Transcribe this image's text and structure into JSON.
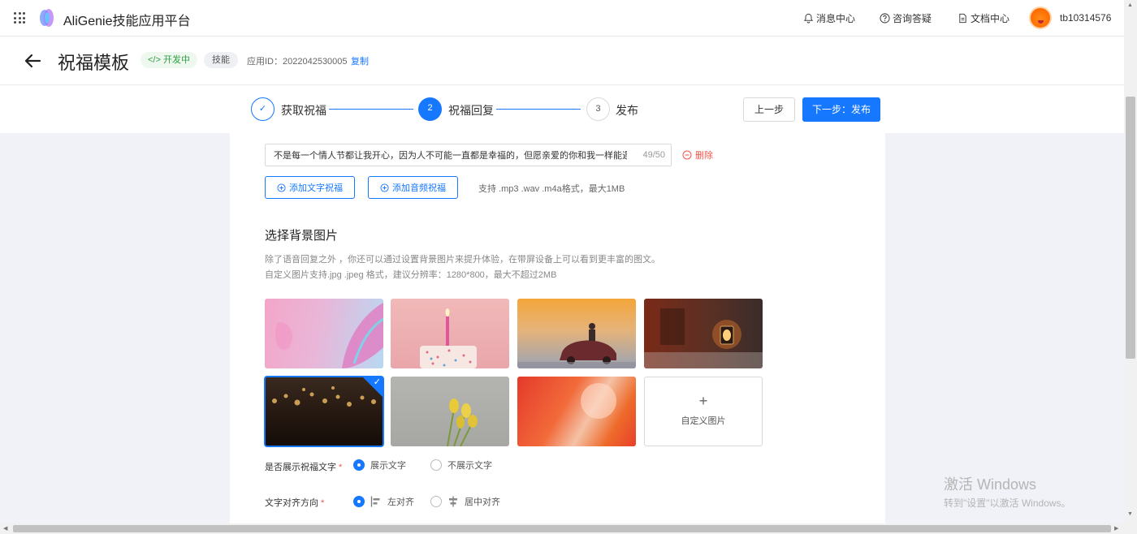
{
  "topnav": {
    "app_title": "AliGenie技能应用平台",
    "messages": "消息中心",
    "faq": "咨询答疑",
    "docs": "文档中心",
    "username": "tb10314576"
  },
  "header": {
    "title": "祝福模板",
    "status_badge": "开发中",
    "type_badge": "技能",
    "app_id": "应用ID：2022042530005",
    "copy_label": "复制"
  },
  "steps": {
    "items": [
      {
        "number": "✓",
        "label": "获取祝福",
        "state": "done"
      },
      {
        "number": "2",
        "label": "祝福回复",
        "state": "active"
      },
      {
        "number": "3",
        "label": "发布",
        "state": "pending"
      }
    ],
    "prev_label": "上一步",
    "next_label": "下一步：发布"
  },
  "blessing": {
    "input_value": "不是每一个情人节都让我开心，因为人不可能一直都是幸福的，但愿亲爱的你和我一样能遇见",
    "char_count": "49/50",
    "delete_label": "删除",
    "add_text_label": "添加文字祝福",
    "add_audio_label": "添加音频祝福",
    "format_hint": "支持 .mp3 .wav .m4a格式，最大1MB"
  },
  "background": {
    "section_title": "选择背景图片",
    "desc_line1": "除了语音回复之外 ，你还可以通过设置背景图片来提升体验，在带屏设备上可以看到更丰富的图文。",
    "desc_line2": "自定义图片支持.jpg .jpeg 格式，建议分辨率：1280*800，最大不超过2MB",
    "custom_label": "自定义图片",
    "selected_index": 4
  },
  "show_text": {
    "label": "是否展示祝福文字",
    "option_show": "展示文字",
    "option_hide": "不展示文字",
    "selected": "show"
  },
  "align": {
    "label": "文字对齐方向",
    "option_left": "左对齐",
    "option_center": "居中对齐",
    "selected": "left"
  },
  "watermark": {
    "line1": "激活 Windows",
    "line2": "转到\"设置\"以激活 Windows。"
  },
  "colors": {
    "primary": "#1677ff",
    "danger": "#f5564a",
    "success": "#2ea043"
  }
}
